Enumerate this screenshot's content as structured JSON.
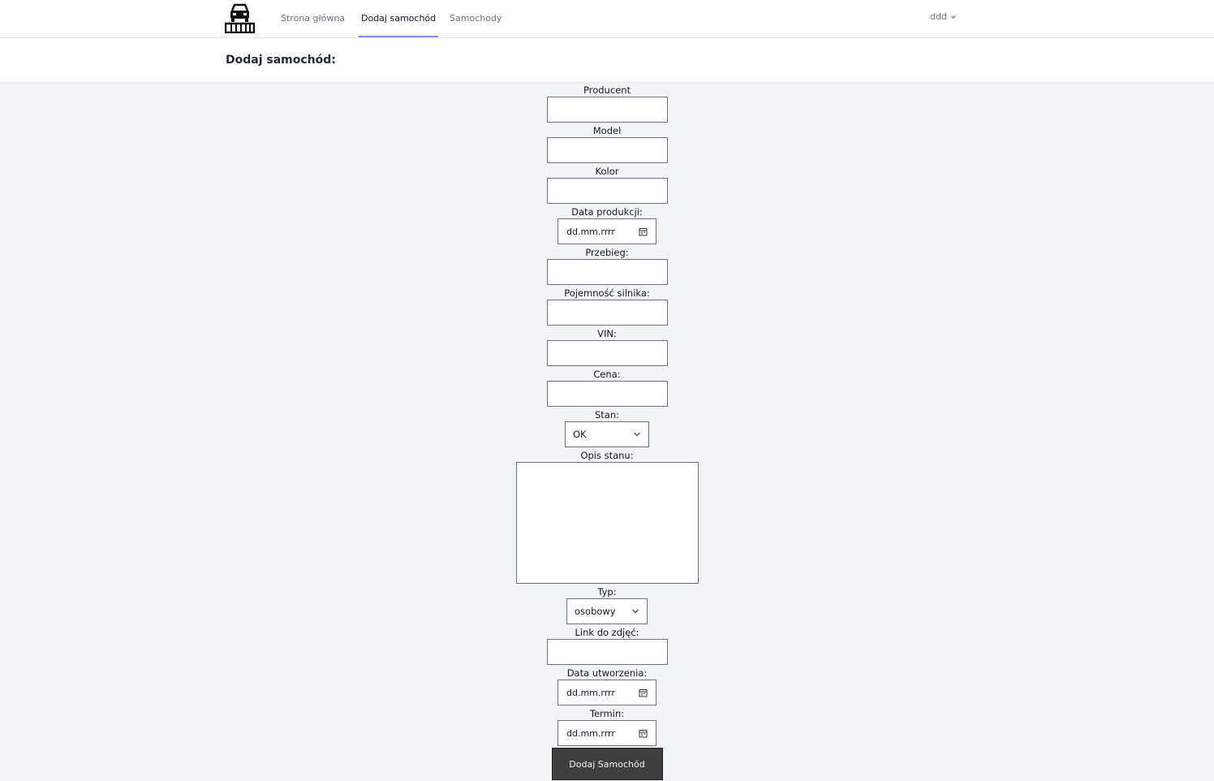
{
  "nav": {
    "links": [
      {
        "label": "Strona główna"
      },
      {
        "label": "Dodaj samochód"
      },
      {
        "label": "Samochody"
      }
    ],
    "user": "ddd"
  },
  "header": {
    "title": "Dodaj samochód:"
  },
  "form": {
    "producent_label": "Producent",
    "model_label": "Model",
    "kolor_label": "Kolor",
    "data_produkcji_label": "Data produkcji:",
    "data_produkcji_value": "dd.mm.rrrr",
    "przebieg_label": "Przebieg:",
    "pojemnosc_label": "Pojemność silnika:",
    "vin_label": "VIN:",
    "cena_label": "Cena:",
    "stan_label": "Stan:",
    "stan_value": "OK",
    "opis_label": "Opis stanu:",
    "typ_label": "Typ:",
    "typ_value": "osobowy",
    "link_label": "Link do zdjęć:",
    "data_utworzenia_label": "Data utworzenia:",
    "data_utworzenia_value": "dd.mm.rrrr",
    "termin_label": "Termin:",
    "termin_value": "dd.mm.rrrr",
    "submit_label": "Dodaj Samochód"
  }
}
